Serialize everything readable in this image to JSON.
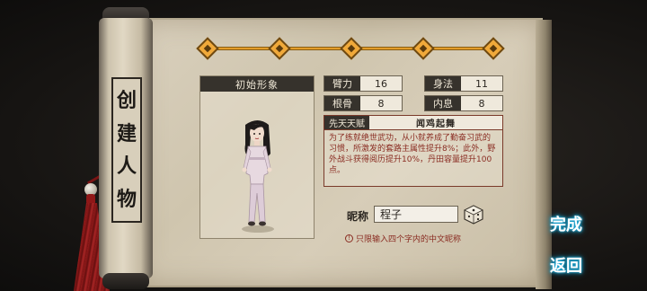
{
  "scroll": {
    "title_chars": [
      "创",
      "建",
      "人",
      "物"
    ]
  },
  "progress": {
    "steps": 5
  },
  "portrait": {
    "header": "初始形象"
  },
  "stats": [
    {
      "label": "臂力",
      "value": "16"
    },
    {
      "label": "身法",
      "value": "11"
    },
    {
      "label": "根骨",
      "value": "8"
    },
    {
      "label": "内息",
      "value": "8"
    }
  ],
  "talent": {
    "label": "先天天赋",
    "name": "闻鸡起舞",
    "description": "为了练就绝世武功，从小就养成了勤奋习武的习惯，所激发的套路主属性提升8%；此外，野外战斗获得阅历提升10%，丹田容量提升100点。"
  },
  "nickname": {
    "label": "昵称",
    "value": "程子",
    "hint": "只限输入四个字内的中文昵称"
  },
  "buttons": {
    "done": "完成",
    "back": "返回"
  },
  "colors": {
    "accent": "#f0a93a",
    "hint": "#8a2c22",
    "glow": "#1bb7e8"
  }
}
